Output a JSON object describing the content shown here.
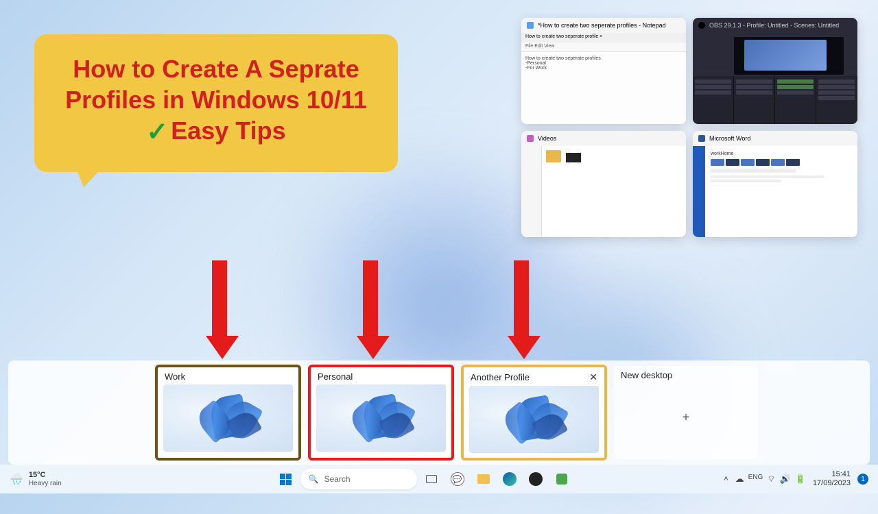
{
  "callout": {
    "line1": "How to Create A Seprate",
    "line2": "Profiles in Windows 10/11",
    "line3": "Easy Tips"
  },
  "taskview_windows": [
    {
      "title": "*How to create two seperate profiles - Notepad",
      "icon_color": "#5aa0f0",
      "kind": "notepad",
      "menu": "File   Edit   View",
      "tab": "How to create two seperate profile  ×",
      "body_lines": [
        "How to create two seperate profiles",
        "-Personal",
        "-For Work"
      ]
    },
    {
      "title": "OBS 29.1.3 - Profile: Untitled - Scenes: Untitled",
      "icon_color": "#222",
      "kind": "obs"
    },
    {
      "title": "Videos",
      "icon_color": "#c060c0",
      "kind": "explorer"
    },
    {
      "title": "Microsoft Word",
      "icon_color": "#2b579a",
      "kind": "word"
    }
  ],
  "desktops": [
    {
      "label": "Work",
      "outline": "brown",
      "closable": false
    },
    {
      "label": "Personal",
      "outline": "red",
      "closable": false
    },
    {
      "label": "Another Profile",
      "outline": "orange",
      "closable": true
    }
  ],
  "new_desktop_label": "New desktop",
  "taskbar": {
    "weather": {
      "temp": "15°C",
      "condition": "Heavy rain"
    },
    "search_placeholder": "Search",
    "time": "15:41",
    "date": "17/09/2023",
    "notif_count": "1"
  }
}
